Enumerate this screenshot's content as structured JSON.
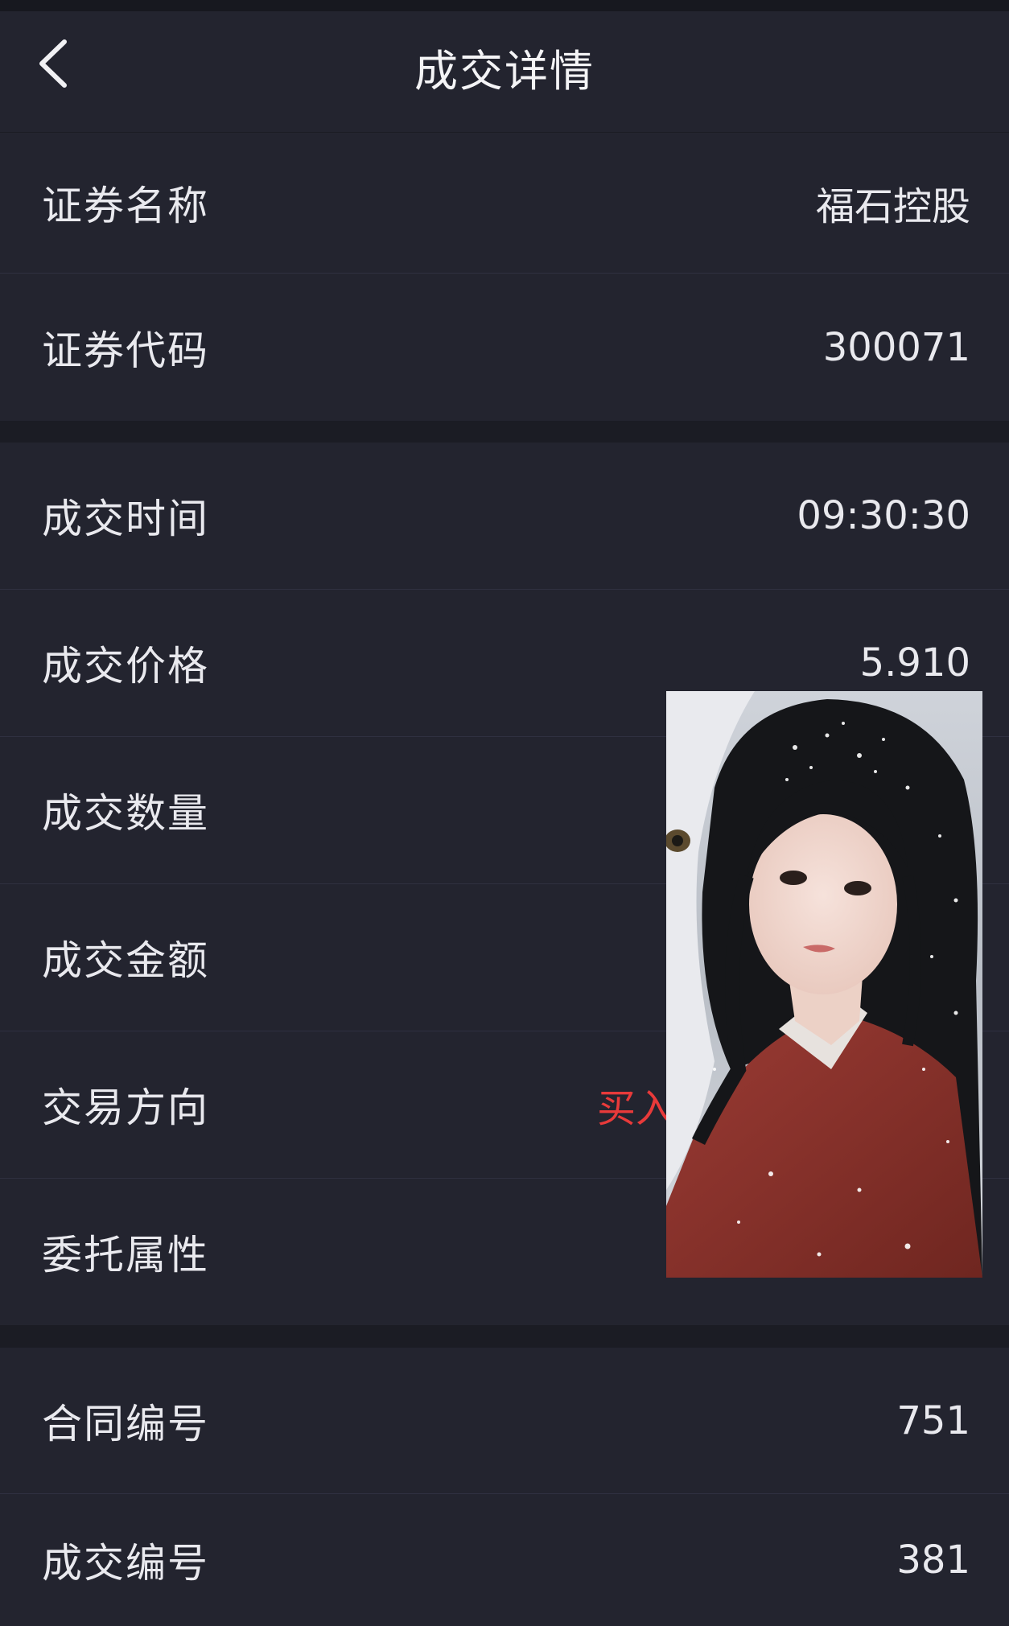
{
  "header": {
    "title": "成交详情"
  },
  "group1": {
    "rows": [
      {
        "label": "证券名称",
        "value": "福石控股"
      },
      {
        "label": "证券代码",
        "value": "300071"
      }
    ]
  },
  "group2": {
    "rows": [
      {
        "label": "成交时间",
        "value": "09:30:30"
      },
      {
        "label": "成交价格",
        "value": "5.910"
      },
      {
        "label": "成交数量",
        "value": ""
      },
      {
        "label": "成交金额",
        "value": ""
      },
      {
        "label": "交易方向",
        "value": "买入"
      },
      {
        "label": "委托属性",
        "value": ""
      }
    ]
  },
  "group3": {
    "rows": [
      {
        "label": "合同编号",
        "value": "751"
      },
      {
        "label": "成交编号",
        "value": "381"
      }
    ]
  },
  "colors": {
    "background": "#1b1c24",
    "panel": "#23242f",
    "buy": "#e83a3a",
    "text": "#e9e9ee"
  }
}
